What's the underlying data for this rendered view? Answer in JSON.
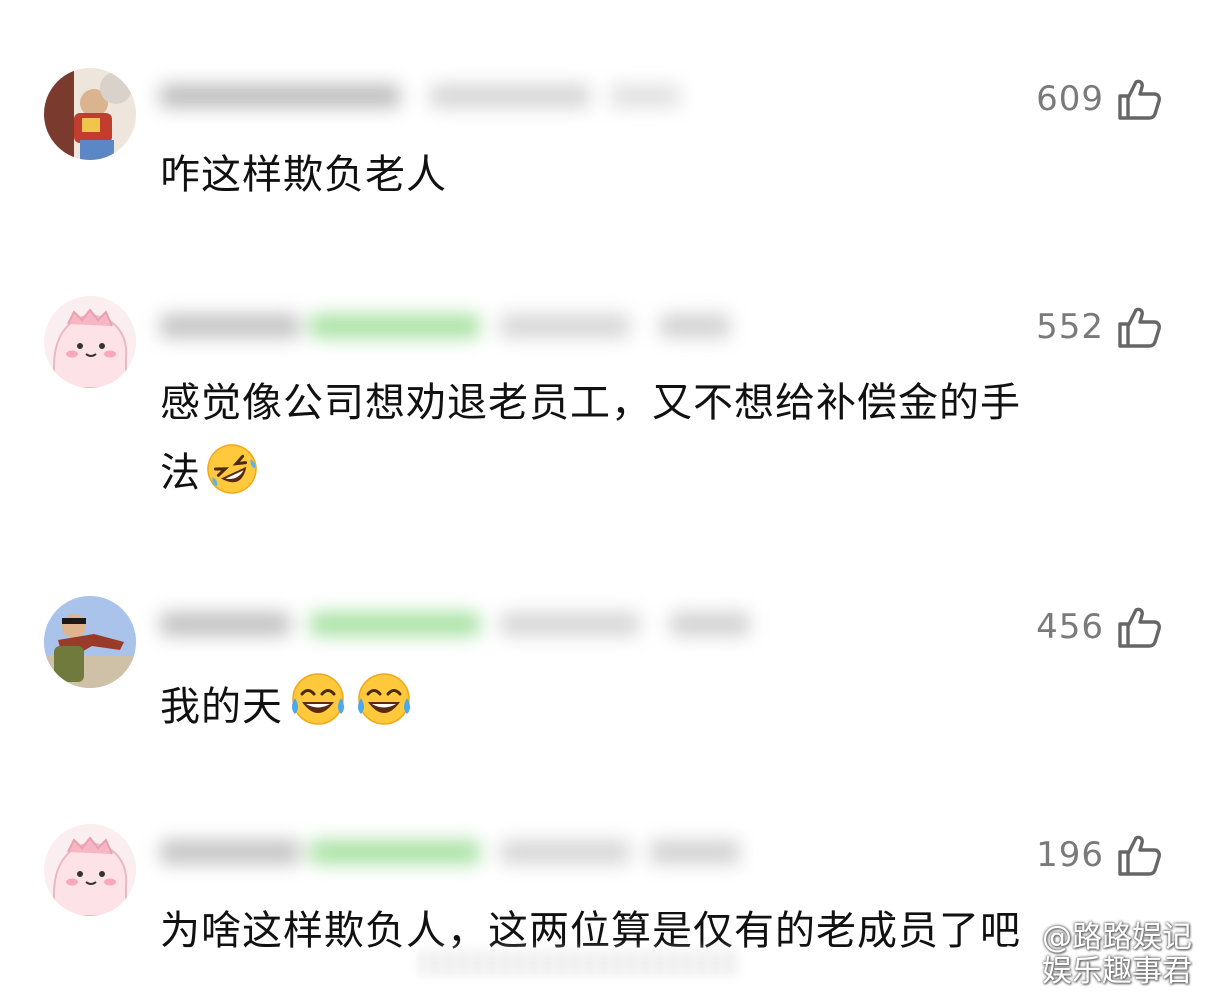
{
  "comments": [
    {
      "likes": "609",
      "text": "咋这样欺负老人",
      "emojis": [],
      "avatar": "photo-avatar"
    },
    {
      "likes": "552",
      "text_line1": "感觉像公司想劝退老员工，又不想给补偿金的手",
      "text_line2": "法",
      "emojis": [
        "rofl-emoji"
      ],
      "avatar": "pink-creature-avatar"
    },
    {
      "likes": "456",
      "text": "我的天",
      "emojis": [
        "tears-of-joy-emoji",
        "tears-of-joy-emoji"
      ],
      "avatar": "photo-avatar"
    },
    {
      "likes": "196",
      "text": "为啥这样欺负人，这两位算是仅有的老成员了吧",
      "emojis": [],
      "avatar": "pink-creature-avatar"
    }
  ],
  "watermark": {
    "line1": "@路路娱记",
    "line2": "娱乐趣事君",
    "logo": "weibo-logo-icon"
  },
  "icons": {
    "like": "thumbs-up-icon"
  }
}
